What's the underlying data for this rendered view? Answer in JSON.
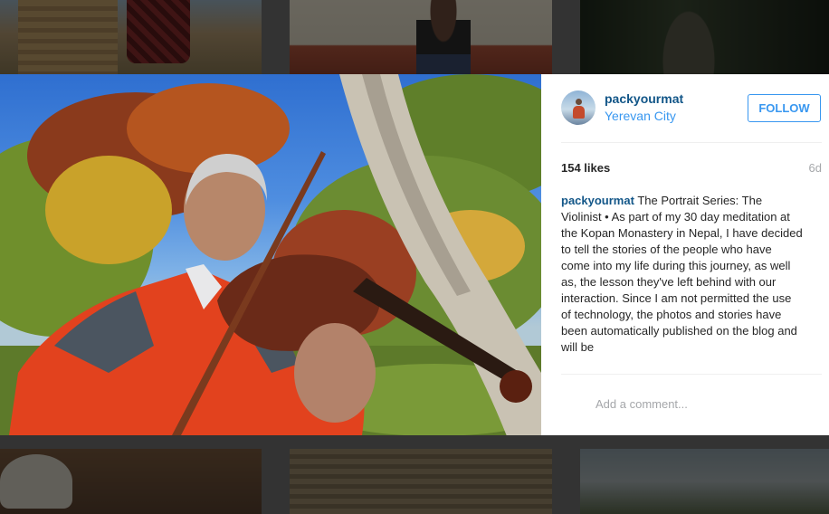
{
  "post": {
    "username": "packyourmat",
    "location": "Yerevan City",
    "follow_label": "FOLLOW",
    "likes": "154 likes",
    "time_ago": "6d",
    "caption_user": "packyourmat",
    "caption_text": "The Portrait Series: The Violinist • As part of my 30 day meditation at the Kopan Monastery in Nepal, I have decided to tell the stories of the people who have come into my life during this journey, as well as, the lesson they've left behind with our interaction. Since I am not permitted the use of technology, the photos and stories have been automatically published on the blog and will be",
    "comment_placeholder": "Add a comment..."
  },
  "colors": {
    "username": "#125688",
    "link": "#3897f0",
    "muted": "#a5a7aa",
    "text": "#262626"
  },
  "icons": {
    "avatar": "user-avatar"
  }
}
